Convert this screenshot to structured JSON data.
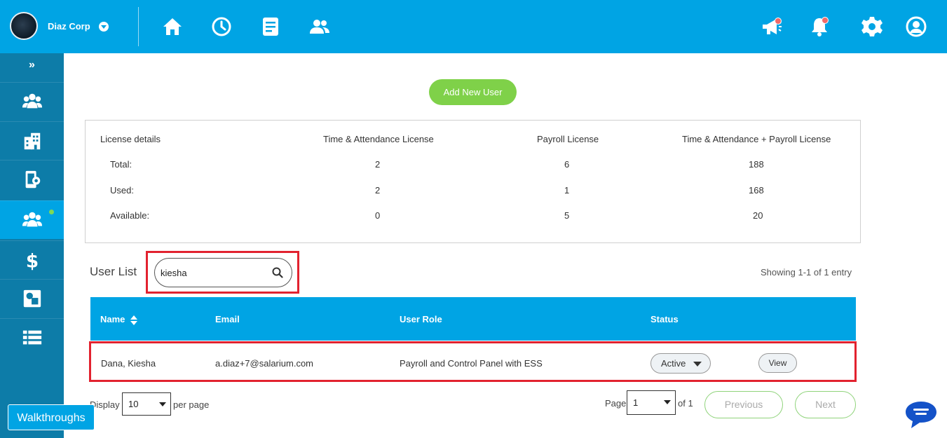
{
  "header": {
    "company_name": "Diaz Corp",
    "accent_color": "#00a4e4",
    "nav_icons": [
      "home-icon",
      "clock-icon",
      "document-icon",
      "users-icon"
    ],
    "right_icons": [
      "megaphone-icon",
      "bell-icon",
      "gear-icon",
      "user-account-icon"
    ]
  },
  "sidebar": {
    "expand_label": "»",
    "items": [
      {
        "icon": "users-group-icon"
      },
      {
        "icon": "building-icon"
      },
      {
        "icon": "mobile-settings-icon"
      },
      {
        "icon": "users-group-icon",
        "active": true
      },
      {
        "icon": "dollar-icon"
      },
      {
        "icon": "shapes-icon"
      },
      {
        "icon": "list-icon"
      }
    ]
  },
  "main": {
    "add_user_label": "Add New User",
    "license": {
      "headers": [
        "License details",
        "Time & Attendance License",
        "Payroll License",
        "Time & Attendance + Payroll License"
      ],
      "rows": [
        {
          "label": "Total:",
          "values": [
            "2",
            "6",
            "188"
          ]
        },
        {
          "label": "Used:",
          "values": [
            "2",
            "1",
            "168"
          ]
        },
        {
          "label": "Available:",
          "values": [
            "0",
            "5",
            "20"
          ]
        }
      ]
    },
    "user_list": {
      "title": "User List",
      "search_value": "kiesha",
      "showing": "Showing 1-1 of 1 entry",
      "columns": [
        "Name",
        "Email",
        "User Role",
        "Status"
      ],
      "rows": [
        {
          "name": "Dana, Kiesha",
          "email": "a.diaz+7@salarium.com",
          "role": "Payroll and Control Panel with ESS",
          "status": "Active",
          "action": "View"
        }
      ]
    },
    "pagination": {
      "display_label": "Display",
      "display_value": "10",
      "per_page_label": "per page",
      "page_label": "Page",
      "page_value": "1",
      "of_label": "of 1",
      "previous_label": "Previous",
      "next_label": "Next"
    },
    "walkthroughs_label": "Walkthroughs"
  }
}
